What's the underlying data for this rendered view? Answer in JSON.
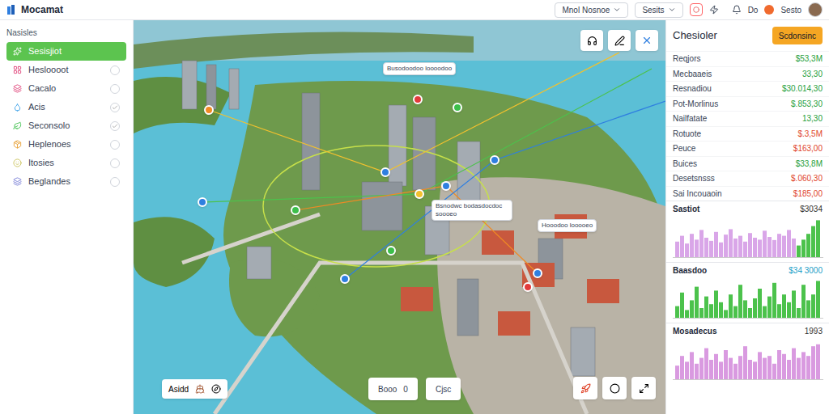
{
  "window": {
    "title": "Mocamat"
  },
  "topbar": {
    "controls": [
      {
        "label": "Mnol Nosnoe",
        "kind": "dropdown"
      },
      {
        "label": "Sesits",
        "kind": "dropdown"
      }
    ],
    "user_a": "Do",
    "user_b": "Sesto"
  },
  "sidebar": {
    "title": "Nasisles",
    "items": [
      {
        "label": "Sesisjiot",
        "selected": true,
        "checked": false,
        "color": "#ffffff"
      },
      {
        "label": "Hesloooot",
        "selected": false,
        "checked": false,
        "color": "#e0457b"
      },
      {
        "label": "Cacalo",
        "selected": false,
        "checked": false,
        "color": "#e0457b"
      },
      {
        "label": "Acis",
        "selected": false,
        "checked": true,
        "color": "#3aa0e8"
      },
      {
        "label": "Seconsolo",
        "selected": false,
        "checked": true,
        "color": "#3cbf4a"
      },
      {
        "label": "Heplenoes",
        "selected": false,
        "checked": false,
        "color": "#e8a23a"
      },
      {
        "label": "Itosies",
        "selected": false,
        "checked": false,
        "color": "#c9c25a"
      },
      {
        "label": "Beglandes",
        "selected": false,
        "checked": false,
        "color": "#7a7fd6"
      }
    ]
  },
  "map": {
    "labels": [
      "Busodoodoo loooodoo",
      "Bsnodwc bodasdocdoc soooeo",
      "Hooodoo looooeo"
    ],
    "pins": [
      {
        "color": "#e23b3b"
      },
      {
        "color": "#2f7fe0"
      },
      {
        "color": "#f2c12e"
      },
      {
        "color": "#3cbf4a"
      },
      {
        "color": "#2f7fe0"
      },
      {
        "color": "#e23b3b"
      },
      {
        "color": "#2f7fe0"
      },
      {
        "color": "#2f7fe0"
      },
      {
        "color": "#2f7fe0"
      },
      {
        "color": "#f08a24"
      },
      {
        "color": "#2f7fe0"
      },
      {
        "color": "#3cbf4a"
      },
      {
        "color": "#3cbf4a"
      }
    ],
    "bottom_left": {
      "label": "Asidd"
    },
    "bottom_center": [
      {
        "label": "Booo",
        "badge": "0"
      },
      {
        "label": "Cjsc"
      }
    ]
  },
  "panel": {
    "title": "Chesioler",
    "button": "Scdonsinc",
    "rows": [
      {
        "label": "Reqjors",
        "value": "$53,3M",
        "color": "#1e9e3a"
      },
      {
        "label": "Mecbaaeis",
        "value": "33,30",
        "color": "#1e9e3a"
      },
      {
        "label": "Resnadiou",
        "value": "$30.014,30",
        "color": "#1e9e3a"
      },
      {
        "label": "Pot-Morlinus",
        "value": "$.853,30",
        "color": "#1e9e3a"
      },
      {
        "label": "Nailfatate",
        "value": "13,30",
        "color": "#1e9e3a"
      },
      {
        "label": "Rotuote",
        "value": "$.3,5M",
        "color": "#e0452b"
      },
      {
        "label": "Peuce",
        "value": "$163,00",
        "color": "#e0452b"
      },
      {
        "label": "Buices",
        "value": "$33,8M",
        "color": "#1e9e3a"
      },
      {
        "label": "Desetsnsss",
        "value": "$.060,30",
        "color": "#e0452b"
      },
      {
        "label": "Sai Incouaoin",
        "value": "$185,00",
        "color": "#e0452b"
      }
    ],
    "charts": [
      {
        "title": "Sastiot",
        "value": "$3034",
        "value_color": "#333333",
        "series": [
          {
            "color": "#d9a6e8",
            "values": [
              40,
              55,
              35,
              60,
              45,
              70,
              50,
              42,
              65,
              38,
              58,
              72,
              48,
              55,
              40,
              62,
              50,
              45,
              68,
              52,
              44,
              60,
              55,
              70,
              48,
              0,
              0,
              0,
              0,
              0
            ]
          },
          {
            "color": "#4cc24c",
            "values": [
              0,
              0,
              0,
              0,
              0,
              0,
              0,
              0,
              0,
              0,
              0,
              0,
              0,
              0,
              0,
              0,
              0,
              0,
              0,
              0,
              0,
              0,
              0,
              0,
              0,
              30,
              45,
              60,
              80,
              95
            ]
          }
        ]
      },
      {
        "title": "Baasdoo",
        "value": "$34 3000",
        "value_color": "#1ea0c8",
        "series": [
          {
            "color": "#4cc24c",
            "values": [
              30,
              65,
              20,
              45,
              80,
              25,
              55,
              35,
              70,
              40,
              20,
              60,
              30,
              85,
              45,
              25,
              50,
              75,
              30,
              55,
              90,
              35,
              60,
              40,
              70,
              25,
              85,
              45,
              60,
              95
            ]
          }
        ]
      },
      {
        "title": "Mosadecus",
        "value": "1993",
        "value_color": "#333333",
        "series": [
          {
            "color": "#d99ae0",
            "values": [
              35,
              60,
              45,
              70,
              40,
              55,
              80,
              50,
              65,
              45,
              75,
              55,
              40,
              60,
              85,
              50,
              45,
              70,
              55,
              60,
              40,
              75,
              65,
              50,
              80,
              55,
              70,
              60,
              85,
              90
            ]
          }
        ]
      }
    ]
  }
}
